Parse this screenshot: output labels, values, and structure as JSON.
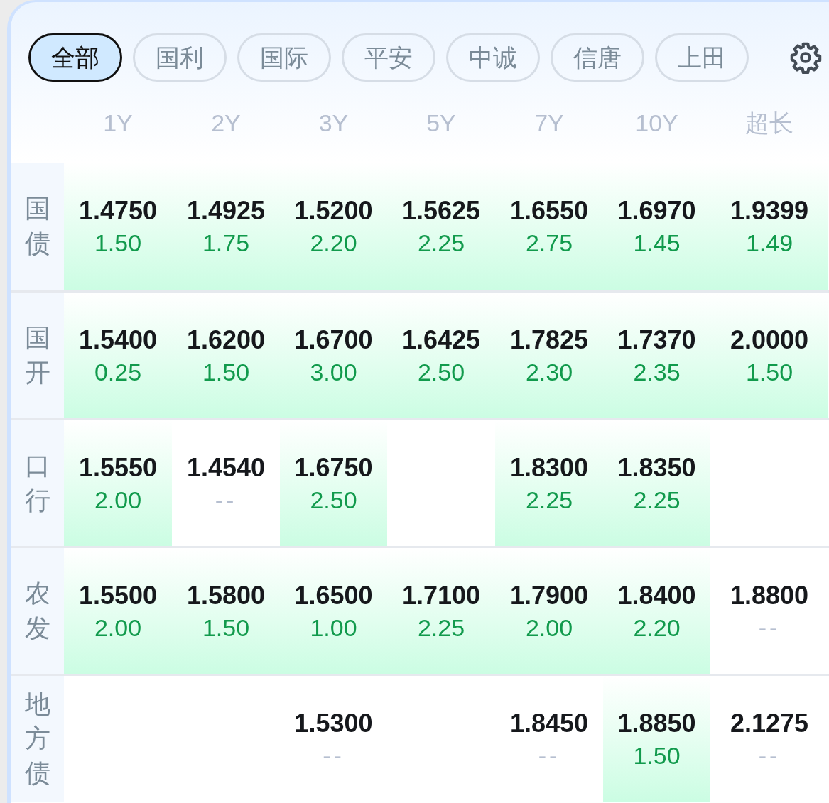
{
  "tabs": [
    {
      "label": "全部",
      "selected": true
    },
    {
      "label": "国利",
      "selected": false
    },
    {
      "label": "国际",
      "selected": false
    },
    {
      "label": "平安",
      "selected": false
    },
    {
      "label": "中诚",
      "selected": false
    },
    {
      "label": "信唐",
      "selected": false
    },
    {
      "label": "上田",
      "selected": false
    }
  ],
  "columns": [
    "1Y",
    "2Y",
    "3Y",
    "5Y",
    "7Y",
    "10Y",
    "超长"
  ],
  "rows": [
    {
      "label": "国债",
      "cells": [
        {
          "kind": "quote",
          "rate": "1.4750",
          "change": "1.50",
          "muted": false,
          "highlighted": true
        },
        {
          "kind": "quote",
          "rate": "1.4925",
          "change": "1.75",
          "muted": false,
          "highlighted": true
        },
        {
          "kind": "quote",
          "rate": "1.5200",
          "change": "2.20",
          "muted": false,
          "highlighted": true
        },
        {
          "kind": "quote",
          "rate": "1.5625",
          "change": "2.25",
          "muted": false,
          "highlighted": true
        },
        {
          "kind": "quote",
          "rate": "1.6550",
          "change": "2.75",
          "muted": false,
          "highlighted": true
        },
        {
          "kind": "quote",
          "rate": "1.6970",
          "change": "1.45",
          "muted": false,
          "highlighted": true
        },
        {
          "kind": "quote",
          "rate": "1.9399",
          "change": "1.49",
          "muted": false,
          "highlighted": true
        }
      ]
    },
    {
      "label": "国开",
      "cells": [
        {
          "kind": "quote",
          "rate": "1.5400",
          "change": "0.25",
          "muted": false,
          "highlighted": true
        },
        {
          "kind": "quote",
          "rate": "1.6200",
          "change": "1.50",
          "muted": false,
          "highlighted": true
        },
        {
          "kind": "quote",
          "rate": "1.6700",
          "change": "3.00",
          "muted": false,
          "highlighted": true
        },
        {
          "kind": "quote",
          "rate": "1.6425",
          "change": "2.50",
          "muted": false,
          "highlighted": true
        },
        {
          "kind": "quote",
          "rate": "1.7825",
          "change": "2.30",
          "muted": false,
          "highlighted": true
        },
        {
          "kind": "quote",
          "rate": "1.7370",
          "change": "2.35",
          "muted": false,
          "highlighted": true
        },
        {
          "kind": "quote",
          "rate": "2.0000",
          "change": "1.50",
          "muted": false,
          "highlighted": true
        }
      ]
    },
    {
      "label": "口行",
      "cells": [
        {
          "kind": "quote",
          "rate": "1.5550",
          "change": "2.00",
          "muted": false,
          "highlighted": true
        },
        {
          "kind": "quote",
          "rate": "1.4540",
          "change": "--",
          "muted": true,
          "highlighted": false
        },
        {
          "kind": "quote",
          "rate": "1.6750",
          "change": "2.50",
          "muted": false,
          "highlighted": true
        },
        {
          "kind": "empty"
        },
        {
          "kind": "quote",
          "rate": "1.8300",
          "change": "2.25",
          "muted": false,
          "highlighted": true
        },
        {
          "kind": "quote",
          "rate": "1.8350",
          "change": "2.25",
          "muted": false,
          "highlighted": true
        },
        {
          "kind": "empty"
        }
      ]
    },
    {
      "label": "农发",
      "cells": [
        {
          "kind": "quote",
          "rate": "1.5500",
          "change": "2.00",
          "muted": false,
          "highlighted": true
        },
        {
          "kind": "quote",
          "rate": "1.5800",
          "change": "1.50",
          "muted": false,
          "highlighted": true
        },
        {
          "kind": "quote",
          "rate": "1.6500",
          "change": "1.00",
          "muted": false,
          "highlighted": true
        },
        {
          "kind": "quote",
          "rate": "1.7100",
          "change": "2.25",
          "muted": false,
          "highlighted": true
        },
        {
          "kind": "quote",
          "rate": "1.7900",
          "change": "2.00",
          "muted": false,
          "highlighted": true
        },
        {
          "kind": "quote",
          "rate": "1.8400",
          "change": "2.20",
          "muted": false,
          "highlighted": true
        },
        {
          "kind": "quote",
          "rate": "1.8800",
          "change": "--",
          "muted": true,
          "highlighted": false
        }
      ]
    },
    {
      "label": "地方债",
      "cells": [
        {
          "kind": "empty"
        },
        {
          "kind": "empty"
        },
        {
          "kind": "quote",
          "rate": "1.5300",
          "change": "--",
          "muted": true,
          "highlighted": false
        },
        {
          "kind": "empty"
        },
        {
          "kind": "quote",
          "rate": "1.8450",
          "change": "--",
          "muted": true,
          "highlighted": false
        },
        {
          "kind": "quote",
          "rate": "1.8850",
          "change": "1.50",
          "muted": false,
          "highlighted": true
        },
        {
          "kind": "quote",
          "rate": "2.1275",
          "change": "--",
          "muted": true,
          "highlighted": false
        }
      ]
    }
  ]
}
